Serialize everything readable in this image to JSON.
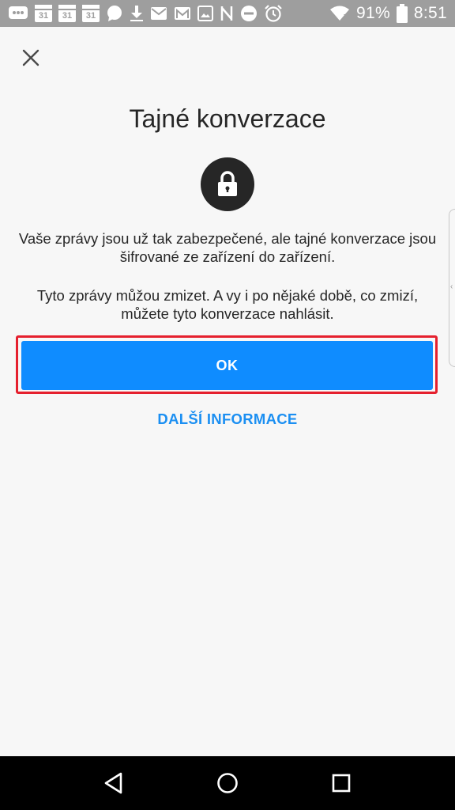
{
  "status_bar": {
    "battery_percent": "91%",
    "time": "8:51",
    "calendar_day": "31",
    "icons": [
      "chat-icon",
      "calendar-icon",
      "calendar-icon",
      "calendar-icon",
      "message-bubble-icon",
      "download-icon",
      "email-icon",
      "gmail-icon",
      "image-icon",
      "nfc-icon",
      "do-not-disturb-icon",
      "alarm-icon",
      "wifi-icon",
      "battery-icon"
    ]
  },
  "dialog": {
    "title": "Tajné konverzace",
    "paragraph1": "Vaše zprávy jsou už tak zabezpečené, ale tajné konverzace jsou šifrované ze zařízení do zařízení.",
    "paragraph2": "Tyto zprávy můžou zmizet. A vy i po nějaké době, co zmizí, můžete tyto konverzace nahlásit.",
    "ok_label": "OK",
    "more_info_label": "DALŠÍ INFORMACE"
  },
  "colors": {
    "accent": "#0f8cff",
    "link": "#1b8ff2",
    "highlight": "#e5202e",
    "status_bar": "#9e9e9e"
  },
  "nav_bar": {
    "icons": [
      "back-icon",
      "home-icon",
      "recents-icon"
    ]
  }
}
